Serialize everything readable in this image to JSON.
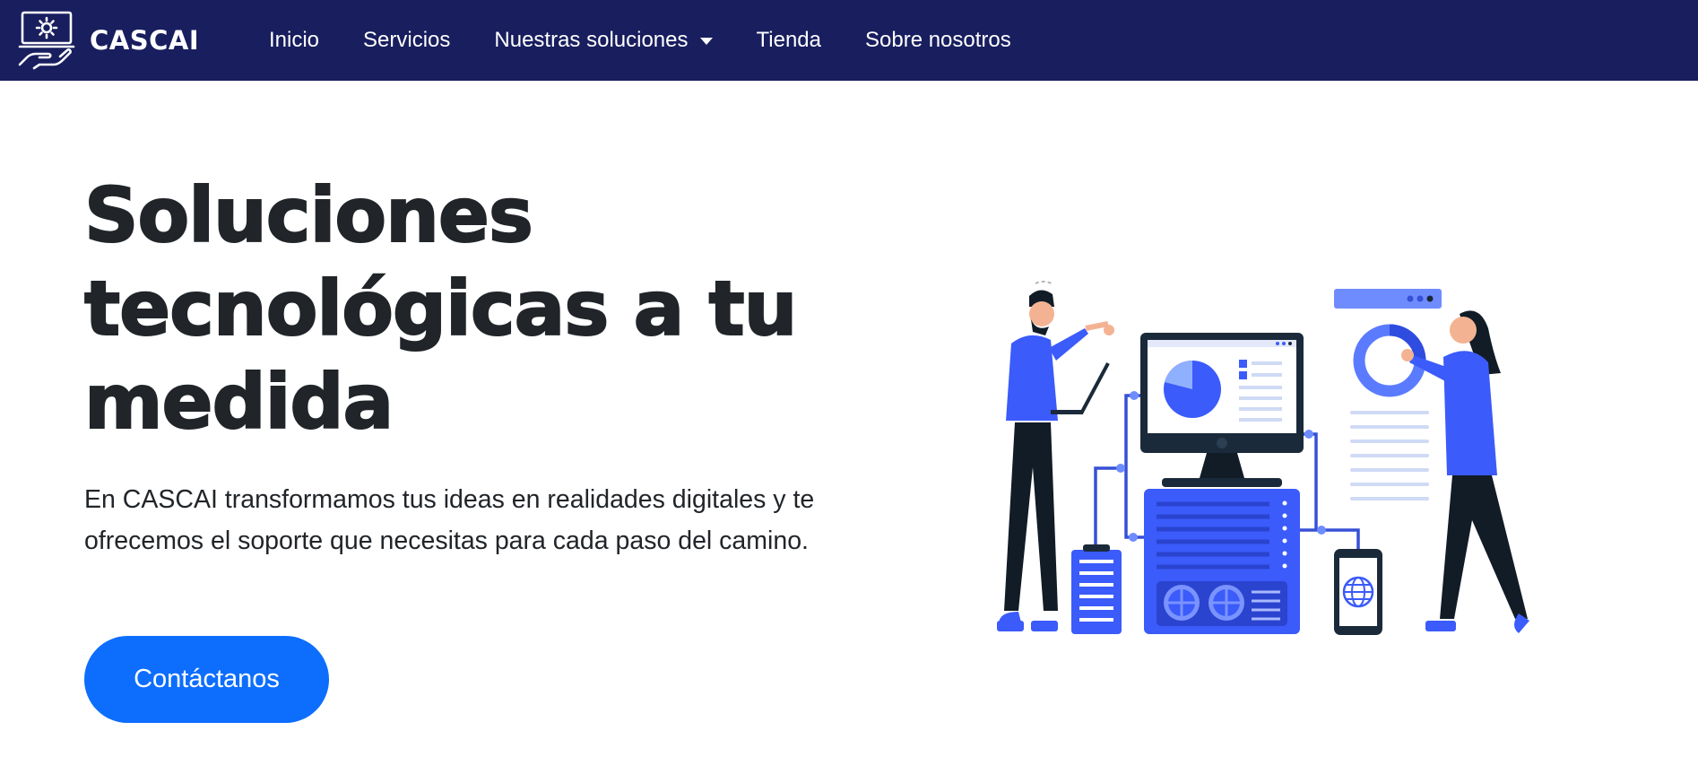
{
  "navbar": {
    "brand_name": "CASCAI",
    "links": [
      {
        "label": "Inicio"
      },
      {
        "label": "Servicios"
      },
      {
        "label": "Nuestras soluciones",
        "has_dropdown": true
      },
      {
        "label": "Tienda"
      },
      {
        "label": "Sobre nosotros"
      }
    ]
  },
  "hero": {
    "title_lines": [
      "Soluciones",
      "tecnológicas a tu",
      "medida"
    ],
    "description": "En CASCAI transformamos tus ideas en realidades digitales y te ofrecemos el soporte que necesitas para cada paso del camino.",
    "cta_label": "Contáctanos"
  },
  "icons": {
    "logo": "laptop-gear-hand-icon",
    "dropdown": "caret-down-icon"
  },
  "colors": {
    "navbar_bg": "#181e5e",
    "primary": "#0d6efd",
    "illustration_blue": "#3b5bfa",
    "illustration_dark": "#1b2a3a",
    "text": "#212529"
  }
}
